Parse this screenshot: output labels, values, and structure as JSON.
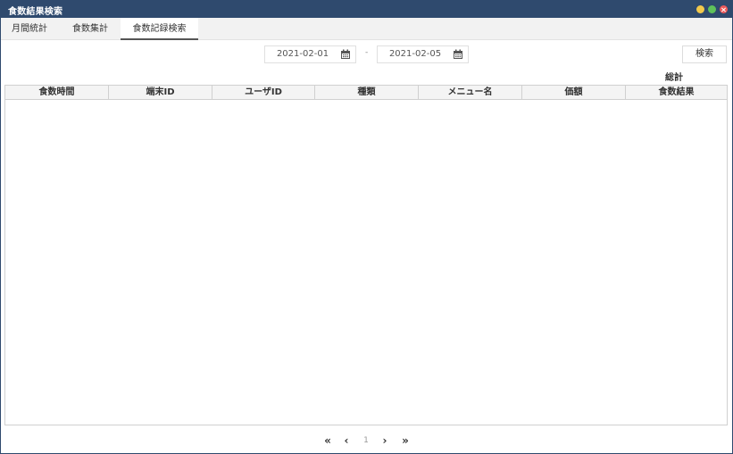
{
  "window": {
    "title": "食数結果検索",
    "colors": {
      "titlebar": "#2f4a6e",
      "minimize": "#f2c94c",
      "maximize": "#5fc25a",
      "close": "#ee5a5a"
    }
  },
  "tabs": [
    {
      "label": "月間統計",
      "active": false
    },
    {
      "label": "食数集計",
      "active": false
    },
    {
      "label": "食数記録検索",
      "active": true
    }
  ],
  "filters": {
    "start_date": "2021-02-01",
    "separator": "-",
    "end_date": "2021-02-05",
    "calendar_icon": "calendar-icon",
    "search_label": "検索"
  },
  "summary": {
    "total_label": "総計"
  },
  "table": {
    "columns": [
      "食数時間",
      "端末ID",
      "ユーザID",
      "種類",
      "メニュー名",
      "価額",
      "食数結果"
    ],
    "rows": []
  },
  "pagination": {
    "first": "«",
    "prev": "‹",
    "current_page": "1",
    "next": "›",
    "last": "»"
  }
}
